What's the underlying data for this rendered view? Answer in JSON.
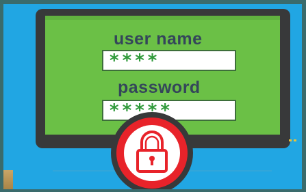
{
  "login_illustration": {
    "username_label": "user name",
    "username_value": "****",
    "password_label": "password",
    "password_value": "*****",
    "lock_icon": "padlock-icon"
  },
  "colors": {
    "background": "#21a6e3",
    "monitor": "#38393a",
    "screen": "#6bc046",
    "label_text": "#34465a",
    "mask_text": "#2f9a3a",
    "lock_ring": "#e8232a"
  }
}
